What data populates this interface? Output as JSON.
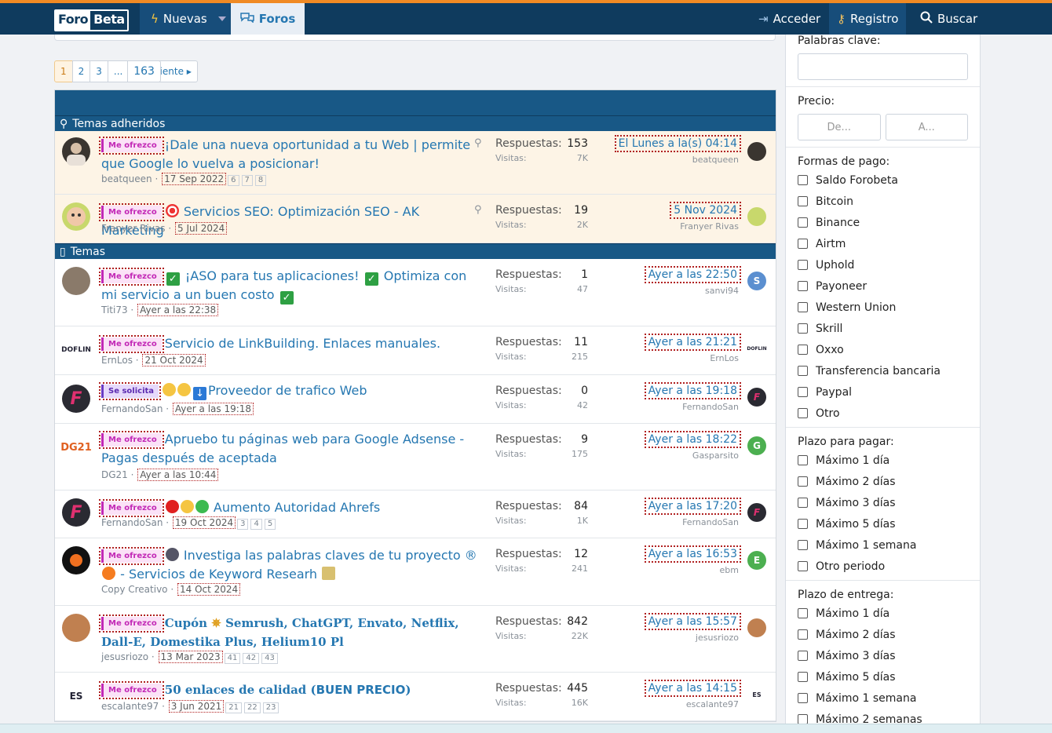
{
  "header": {
    "logo_a": "Foro",
    "logo_b": "Beta",
    "nav_nuevas": "Nuevas",
    "nav_foros": "Foros",
    "acceder": "Acceder",
    "registro": "Registro",
    "buscar": "Buscar"
  },
  "pagination": {
    "pages": [
      "1",
      "2",
      "3",
      "...",
      "163"
    ],
    "current": "1",
    "next": "Siguiente"
  },
  "sections": {
    "sticky": "Temas adheridos",
    "normal": "Temas"
  },
  "labels_text": {
    "ofrezco": "Me ofrezco",
    "solicita": "Se solicita"
  },
  "stat_keys": {
    "replies": "Respuestas:",
    "views": "Visitas:"
  },
  "threads": [
    {
      "label": "Me ofrezco",
      "title": "¡Dale una nueva oportunidad a tu Web | permite que Google lo vuelva a posicionar!",
      "author": "beatqueen",
      "date": "17 Sep 2022",
      "pages": [
        "6",
        "7",
        "8"
      ],
      "replies": "153",
      "views": "7K",
      "last_date": "El Lunes a la(s) 04:14",
      "last_user": "beatqueen",
      "sticky": true
    },
    {
      "label": "Me ofrezco",
      "title": "Servicios SEO: Optimización SEO - AK Marketing",
      "author": "Franyer Rivas",
      "date": "5 Jul 2024",
      "pages": [],
      "replies": "19",
      "views": "2K",
      "last_date": "5 Nov 2024",
      "last_user": "Franyer Rivas",
      "sticky": true
    },
    {
      "label": "Me ofrezco",
      "title_a": "¡ASO para tus aplicaciones!",
      "title_b": "Optimiza con mi servicio a un buen costo",
      "author": "Titi73",
      "date": "Ayer a las 22:38",
      "pages": [],
      "replies": "1",
      "views": "47",
      "last_date": "Ayer a las 22:50",
      "last_user": "sanvi94",
      "last_initial": "S"
    },
    {
      "label": "Me ofrezco",
      "title": "Servicio de LinkBuilding. Enlaces manuales.",
      "author": "ErnLos",
      "date": "21 Oct 2024",
      "pages": [],
      "replies": "11",
      "views": "215",
      "last_date": "Ayer a las 21:21",
      "last_user": "ErnLos",
      "avatar_text": "DOFLIN"
    },
    {
      "label": "Se solicita",
      "title": "Proveedor de trafico Web",
      "author": "FernandoSan",
      "date": "Ayer a las 19:18",
      "pages": [],
      "replies": "0",
      "views": "42",
      "last_date": "Ayer a las 19:18",
      "last_user": "FernandoSan"
    },
    {
      "label": "Me ofrezco",
      "title": "Apruebo tu páginas web para Google Adsense - Pagas después de aceptada",
      "author": "DG21",
      "date": "Ayer a las 10:44",
      "pages": [],
      "replies": "9",
      "views": "175",
      "last_date": "Ayer a las 18:22",
      "last_user": "Gasparsito",
      "last_initial": "G",
      "avatar_text": "DG21"
    },
    {
      "label": "Me ofrezco",
      "title": "Aumento Autoridad Ahrefs",
      "author": "FernandoSan",
      "date": "19 Oct 2024",
      "pages": [
        "3",
        "4",
        "5"
      ],
      "replies": "84",
      "views": "1K",
      "last_date": "Ayer a las 17:20",
      "last_user": "FernandoSan"
    },
    {
      "label": "Me ofrezco",
      "title_a": "Investiga las palabras claves de tu proyecto ®",
      "title_b": "- Servicios de Keyword Researh",
      "author": "Copy Creativo",
      "date": "14 Oct 2024",
      "pages": [],
      "replies": "12",
      "views": "241",
      "last_date": "Ayer a las 16:53",
      "last_user": "ebm",
      "last_initial": "E"
    },
    {
      "label": "Me ofrezco",
      "title_a": "Cupón",
      "title_b": "Semrush, ChatGPT, Envato, Netflix, Dall-E, Domestika Plus, Helium10 Pl",
      "author": "jesusriozo",
      "date": "13 Mar 2023",
      "pages": [
        "41",
        "42",
        "43"
      ],
      "replies": "842",
      "views": "22K",
      "last_date": "Ayer a las 15:57",
      "last_user": "jesusriozo"
    },
    {
      "label": "Me ofrezco",
      "title_a": "50 enlaces de calidad (",
      "title_b": "BUEN PRECIO",
      "title_c": ")",
      "author": "escalante97",
      "date": "3 Jun 2021",
      "pages": [
        "21",
        "22",
        "23"
      ],
      "replies": "445",
      "views": "16K",
      "last_date": "Ayer a las 14:15",
      "last_user": "escalante97",
      "avatar_text": "ES"
    }
  ],
  "sidebar": {
    "keywords_label": "Palabras clave:",
    "price_label": "Precio:",
    "price_from": "De...",
    "price_to": "A...",
    "payment_label": "Formas de pago:",
    "payment": [
      "Saldo Forobeta",
      "Bitcoin",
      "Binance",
      "Airtm",
      "Uphold",
      "Payoneer",
      "Western Union",
      "Skrill",
      "Oxxo",
      "Transferencia bancaria",
      "Paypal",
      "Otro"
    ],
    "pay_term_label": "Plazo para pagar:",
    "pay_term": [
      "Máximo 1 día",
      "Máximo 2 días",
      "Máximo 3 días",
      "Máximo 5 días",
      "Máximo 1 semana",
      "Otro periodo"
    ],
    "delivery_label": "Plazo de entrega:",
    "delivery": [
      "Máximo 1 día",
      "Máximo 2 días",
      "Máximo 3 días",
      "Máximo 5 días",
      "Máximo 1 semana",
      "Máximo 2 semanas"
    ]
  }
}
